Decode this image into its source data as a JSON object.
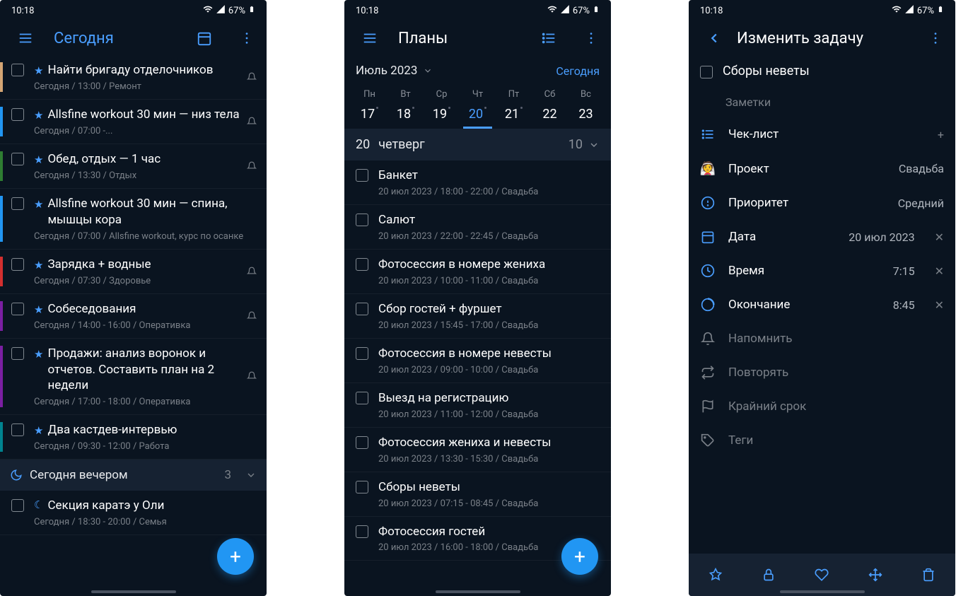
{
  "status": {
    "time": "10:18",
    "battery": "67%"
  },
  "screen1": {
    "title": "Сегодня",
    "tasks": [
      {
        "color": "#d4a574",
        "star": true,
        "title": "Найти бригаду отделочников",
        "meta": "Сегодня / 13:00 / Ремонт",
        "bell": true
      },
      {
        "color": "#2196f3",
        "star": true,
        "title": "Allsfine workout 30 мин — низ тела",
        "meta": "Сегодня / 07:00 -...",
        "bell": true
      },
      {
        "color": "#2e7d32",
        "star": true,
        "title": "Обед, отдых — 1 час",
        "meta": "Сегодня / 13:30 / Отдых",
        "bell": true
      },
      {
        "color": "#2196f3",
        "star": true,
        "title": "Allsfine workout 30 мин — спина, мышцы кора",
        "meta": "Сегодня / 07:00 / Allsfine workout, курс по осанке",
        "bell": false
      },
      {
        "color": "#d32f2f",
        "star": true,
        "title": "Зарядка + водные",
        "meta": "Сегодня / 07:30 / Здоровье",
        "bell": true
      },
      {
        "color": "#7b1fa2",
        "star": true,
        "title": "Собеседования",
        "meta": "Сегодня / 14:00 - 16:00 / Оперативка",
        "bell": true
      },
      {
        "color": "#7b1fa2",
        "star": true,
        "title": "Продажи: анализ воронок и отчетов. Составить план на 2 недели",
        "meta": "Сегодня / 17:00 - 18:00 / Оперативка",
        "bell": true
      },
      {
        "color": "#00838f",
        "star": true,
        "title": "Два кастдев-интервью",
        "meta": "Сегодня / 09:30 - 12:00 / Работа",
        "bell": false
      }
    ],
    "evening": {
      "label": "Сегодня вечером",
      "count": "3"
    },
    "eveningTask": {
      "title": "Секция каратэ у Оли",
      "meta": "Сегодня / 18:30 - 20:00 / Семья"
    }
  },
  "screen2": {
    "title": "Планы",
    "month": "Июль 2023",
    "today": "Сегодня",
    "days": [
      {
        "name": "Пн",
        "num": "17"
      },
      {
        "name": "Вт",
        "num": "18"
      },
      {
        "name": "Ср",
        "num": "19"
      },
      {
        "name": "Чт",
        "num": "20"
      },
      {
        "name": "Пт",
        "num": "21"
      },
      {
        "name": "Сб",
        "num": "22"
      },
      {
        "name": "Вс",
        "num": "23"
      }
    ],
    "daySection": {
      "num": "20",
      "name": "четверг",
      "count": "10"
    },
    "tasks": [
      {
        "title": "Банкет",
        "meta": "20 июл 2023 / 18:00 - 22:00 / Свадьба"
      },
      {
        "title": "Салют",
        "meta": "20 июл 2023 / 22:00 - 22:45 / Свадьба"
      },
      {
        "title": "Фотосессия в номере жениха",
        "meta": "20 июл 2023 / 10:00 - 11:00 / Свадьба"
      },
      {
        "title": "Сбор гостей + фуршет",
        "meta": "20 июл 2023 / 15:45 - 17:00 / Свадьба"
      },
      {
        "title": "Фотосессия в номере невесты",
        "meta": "20 июл 2023 / 09:00 - 10:00 / Свадьба"
      },
      {
        "title": "Выезд на регистрацию",
        "meta": "20 июл 2023 / 11:00 - 12:00 / Свадьба"
      },
      {
        "title": "Фотосессия жениха и невесты",
        "meta": "20 июл 2023 / 13:30 - 15:30 / Свадьба"
      },
      {
        "title": "Сборы неветы",
        "meta": "20 июл 2023 / 07:15 - 08:45 / Свадьба"
      },
      {
        "title": "Фотосессия гостей",
        "meta": "20 июл 2023 / 16:00 - 18:00 / Свадьба"
      }
    ]
  },
  "screen3": {
    "title": "Изменить задачу",
    "taskTitle": "Сборы неветы",
    "notes": "Заметки",
    "rows": {
      "checklist": "Чек-лист",
      "project": {
        "label": "Проект",
        "value": "Свадьба"
      },
      "priority": {
        "label": "Приоритет",
        "value": "Средний"
      },
      "date": {
        "label": "Дата",
        "value": "20 июл 2023"
      },
      "time": {
        "label": "Время",
        "value": "7:15"
      },
      "end": {
        "label": "Окончание",
        "value": "8:45"
      },
      "remind": "Напомнить",
      "repeat": "Повторять",
      "deadline": "Крайний срок",
      "tags": "Теги"
    }
  }
}
